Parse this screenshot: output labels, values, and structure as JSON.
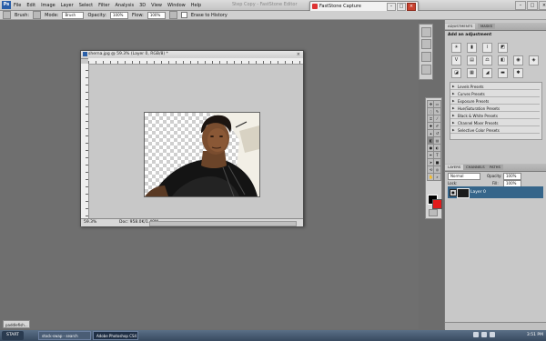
{
  "app": {
    "logo": "Ps",
    "title": "Step Copy - FastStone Editor"
  },
  "menu": [
    "File",
    "Edit",
    "Image",
    "Layer",
    "Select",
    "Filter",
    "Analysis",
    "3D",
    "View",
    "Window",
    "Help"
  ],
  "faststone": {
    "title": "FastStone Capture"
  },
  "options": {
    "brush_label": "Brush:",
    "mode_label": "Mode:",
    "mode_value": "Brush",
    "opacity_label": "Opacity:",
    "opacity_value": "100%",
    "flow_label": "Flow:",
    "flow_value": "100%",
    "erase_history_label": "Erase to History"
  },
  "document": {
    "tab_title": "sherna.jpg @ 59.3% (Layer 0, RGB/8) *",
    "zoom": "59.3%",
    "info": "Doc: 958.0K/1.48M"
  },
  "panels": {
    "adjustments_tabs": [
      "ADJUSTMENTS",
      "MASKS"
    ],
    "adjustments_heading": "Add an adjustment",
    "presets": [
      "Levels Presets",
      "Curves Presets",
      "Exposure Presets",
      "Hue/Saturation Presets",
      "Black & White Presets",
      "Channel Mixer Presets",
      "Selective Color Presets"
    ],
    "layers_tabs": [
      "LAYERS",
      "CHANNELS",
      "PATHS"
    ],
    "blend_mode": "Normal",
    "opacity_label": "Opacity:",
    "opacity_value": "100%",
    "lock_label": "Lock:",
    "fill_label": "Fill:",
    "fill_value": "100%",
    "layer_name": "Layer 0"
  },
  "taskbar": {
    "start": "START",
    "items": [
      "stock-swap - search",
      "Adobe Photoshop CS4",
      "paddlefish..."
    ],
    "clock": "3:51 PM"
  },
  "minimized": {
    "label": "paddlefish..."
  }
}
